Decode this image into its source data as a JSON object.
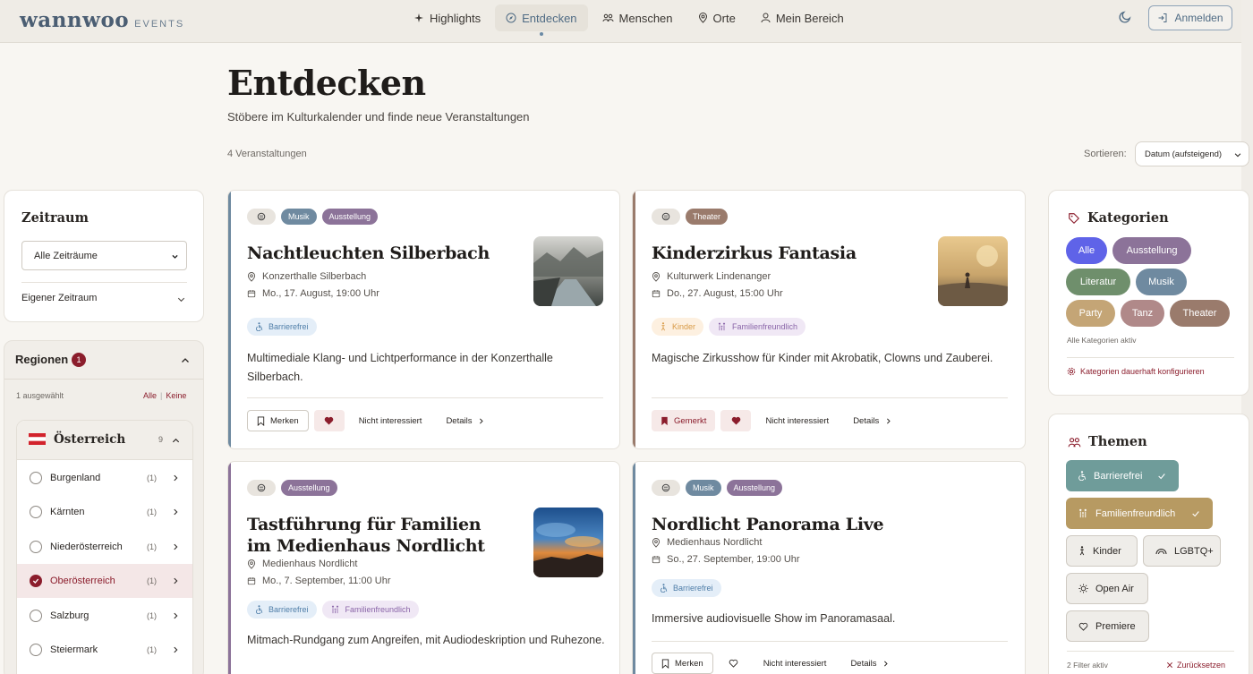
{
  "header": {
    "logo_main": "wannwoo",
    "logo_sub": "EVENTS",
    "nav": [
      {
        "label": "Highlights",
        "icon": "sparkle-icon"
      },
      {
        "label": "Entdecken",
        "icon": "compass-icon",
        "active": true
      },
      {
        "label": "Menschen",
        "icon": "people-icon"
      },
      {
        "label": "Orte",
        "icon": "map-pin-icon"
      },
      {
        "label": "Mein Bereich",
        "icon": "user-icon"
      }
    ],
    "login_label": "Anmelden"
  },
  "page": {
    "title": "Entdecken",
    "subtitle": "Stöbere im Kulturkalender und finde neue Veranstaltungen",
    "count": "4 Veranstaltungen",
    "sort_label": "Sortieren:",
    "sort_value": "Datum (aufsteigend)"
  },
  "zeitraum": {
    "title": "Zeitraum",
    "select_value": "Alle Zeiträume",
    "custom_label": "Eigener Zeitraum"
  },
  "regionen": {
    "title": "Regionen",
    "badge": "1",
    "selected_text": "1 ausgewählt",
    "link_all": "Alle",
    "link_sep": "|",
    "link_none": "Keine",
    "country": {
      "name": "Österreich",
      "count": "9"
    },
    "states": [
      {
        "name": "Burgenland",
        "count": "(1)",
        "selected": false
      },
      {
        "name": "Kärnten",
        "count": "(1)",
        "selected": false
      },
      {
        "name": "Niederösterreich",
        "count": "(1)",
        "selected": false
      },
      {
        "name": "Oberösterreich",
        "count": "(1)",
        "selected": true
      },
      {
        "name": "Salzburg",
        "count": "(1)",
        "selected": false
      },
      {
        "name": "Steiermark",
        "count": "(1)",
        "selected": false
      }
    ]
  },
  "events": [
    {
      "tags": [
        "Musik",
        "Ausstellung"
      ],
      "title": "Nachtleuchten Silberbach",
      "venue": "Konzerthalle Silberbach",
      "date": "Mo., 17. August, 19:00 Uhr",
      "features": [
        "Barrierefrei"
      ],
      "description": "Multimediale Klang- und Lichtperformance in der Konzerthalle Silberbach.",
      "save_label": "Merken",
      "not_interested": "Nicht interessiert",
      "details": "Details"
    },
    {
      "tags": [
        "Theater"
      ],
      "title": "Kinderzirkus Fantasia",
      "venue": "Kulturwerk Lindenanger",
      "date": "Do., 27. August, 15:00 Uhr",
      "features": [
        "Kinder",
        "Familienfreundlich"
      ],
      "description": "Magische Zirkusshow für Kinder mit Akrobatik, Clowns und Zauberei.",
      "save_label": "Gemerkt",
      "not_interested": "Nicht interessiert",
      "details": "Details"
    },
    {
      "tags": [
        "Ausstellung"
      ],
      "title": "Tastführung für Familien im Medienhaus Nordlicht",
      "venue": "Medienhaus Nordlicht",
      "date": "Mo., 7. September, 11:00 Uhr",
      "features": [
        "Barrierefrei",
        "Familienfreundlich"
      ],
      "description": "Mitmach-Rundgang zum Angreifen, mit Audiodeskription und Ruhezone."
    },
    {
      "tags": [
        "Musik",
        "Ausstellung"
      ],
      "title": "Nordlicht Panorama Live",
      "venue": "Medienhaus Nordlicht",
      "date": "So., 27. September, 19:00 Uhr",
      "features": [
        "Barrierefrei"
      ],
      "description": "Immersive audiovisuelle Show im Panoramasaal.",
      "save_label": "Merken",
      "not_interested": "Nicht interessiert",
      "details": "Details"
    }
  ],
  "kategorien": {
    "title": "Kategorien",
    "chips": [
      "Alle",
      "Ausstellung",
      "Literatur",
      "Musik",
      "Party",
      "Tanz",
      "Theater"
    ],
    "note": "Alle Kategorien aktiv",
    "configure": "Kategorien dauerhaft konfigurieren"
  },
  "themen": {
    "title": "Themen",
    "chips": [
      "Barrierefrei",
      "Familienfreundlich",
      "Kinder",
      "LGBTQ+",
      "Open Air",
      "Premiere"
    ],
    "note": "2 Filter aktiv",
    "reset": "Zurücksetzen"
  },
  "colors": {
    "accent_red": "#8b1d2c",
    "musik": "#6f8aa0",
    "ausstellung": "#8c7399",
    "theater": "#9a7b6c",
    "alle": "#5f63e8",
    "literatur": "#6f8f6c",
    "party": "#c4a576",
    "tanz": "#b08989"
  }
}
